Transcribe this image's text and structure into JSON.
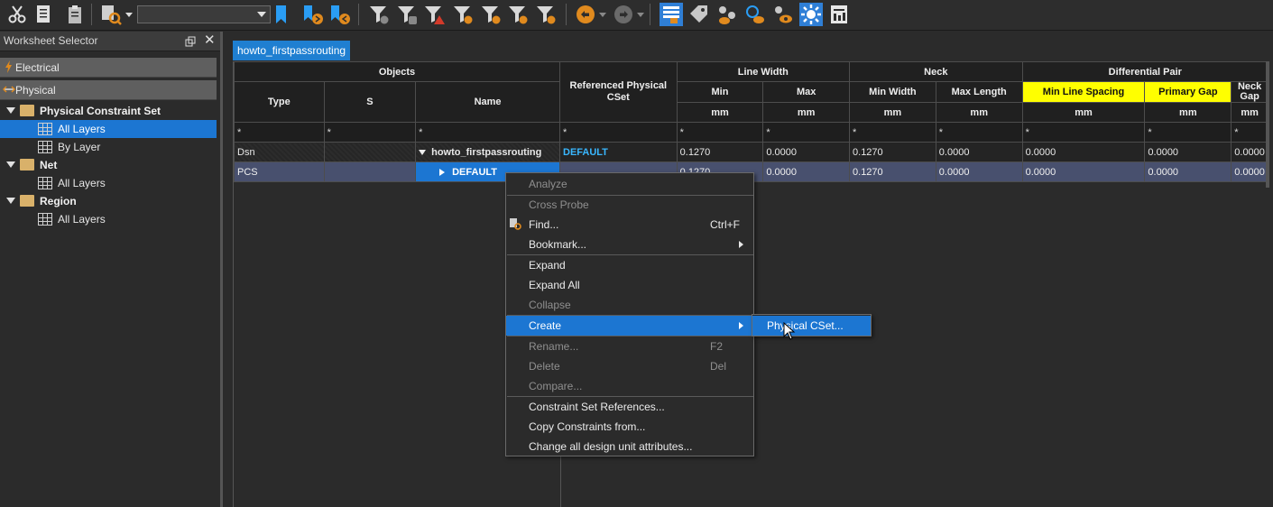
{
  "colors": {
    "accent": "#1c76d2",
    "highlight": "#ffff00",
    "link": "#39b7ff",
    "folder": "#d9b16a"
  },
  "toolbar": {
    "icons": [
      "scissors-icon",
      "copy-icon",
      "paste-icon",
      "find-icon",
      "bookmark-icon",
      "bookmark-next-icon",
      "bookmark-prev-icon",
      "filter-icon",
      "filter-icon",
      "filter-error-icon",
      "filter-icon",
      "filter-icon",
      "filter-icon",
      "filter-icon",
      "undo-icon",
      "redo-icon",
      "worksheet-icon",
      "tag-icon",
      "eye-icon",
      "eye-icon",
      "eye-icon",
      "settings-icon",
      "report-icon"
    ],
    "combo_value": ""
  },
  "worksheet_selector": {
    "title": "Worksheet Selector",
    "categories": [
      {
        "label": "Electrical",
        "icon": "lightning-icon"
      },
      {
        "label": "Physical",
        "icon": "physical-icon"
      }
    ],
    "tree": [
      {
        "label": "Physical Constraint Set",
        "bold": true
      },
      {
        "label": "All Layers",
        "selected": true
      },
      {
        "label": "By Layer"
      },
      {
        "label": "Net",
        "bold": true
      },
      {
        "label": "All Layers"
      },
      {
        "label": "Region",
        "bold": true
      },
      {
        "label": "All Layers"
      }
    ]
  },
  "document": {
    "tab_label": "howto_firstpassrouting"
  },
  "grid": {
    "headers": {
      "objects": "Objects",
      "type": "Type",
      "s": "S",
      "name": "Name",
      "ref_cset": "Referenced Physical CSet",
      "line_width": "Line Width",
      "neck": "Neck",
      "diff_pair": "Differential Pair",
      "min": "Min",
      "max": "Max",
      "min_width": "Min Width",
      "max_length": "Max Length",
      "min_line_spacing": "Min Line Spacing",
      "primary_gap": "Primary Gap",
      "neck_gap": "Neck Gap",
      "unit": "mm",
      "filter": "*"
    },
    "rows": [
      {
        "type": "Dsn",
        "s": "",
        "name": "howto_firstpassrouting",
        "ref": "DEFAULT",
        "lw_min": "0.1270",
        "lw_max": "0.0000",
        "neck_min": "0.1270",
        "neck_max": "0.0000",
        "mls": "0.0000",
        "pgap": "0.0000",
        "ngap": "0.0000"
      },
      {
        "type": "PCS",
        "s": "",
        "name": "DEFAULT",
        "ref": "",
        "lw_min": "0.1270",
        "lw_max": "0.0000",
        "neck_min": "0.1270",
        "neck_max": "0.0000",
        "mls": "0.0000",
        "pgap": "0.0000",
        "ngap": "0.0000"
      }
    ]
  },
  "context_menu": {
    "analyze": "Analyze",
    "cross_probe": "Cross Probe",
    "find": "Find...",
    "find_sc": "Ctrl+F",
    "bookmark": "Bookmark...",
    "expand": "Expand",
    "expand_all": "Expand All",
    "collapse": "Collapse",
    "create": "Create",
    "rename": "Rename...",
    "rename_sc": "F2",
    "delete": "Delete",
    "delete_sc": "Del",
    "compare": "Compare...",
    "cset_refs": "Constraint Set References...",
    "copy_constraints": "Copy Constraints from...",
    "change_units": "Change all design unit attributes..."
  },
  "sub_menu": {
    "physical_cset": "Physical CSet..."
  }
}
